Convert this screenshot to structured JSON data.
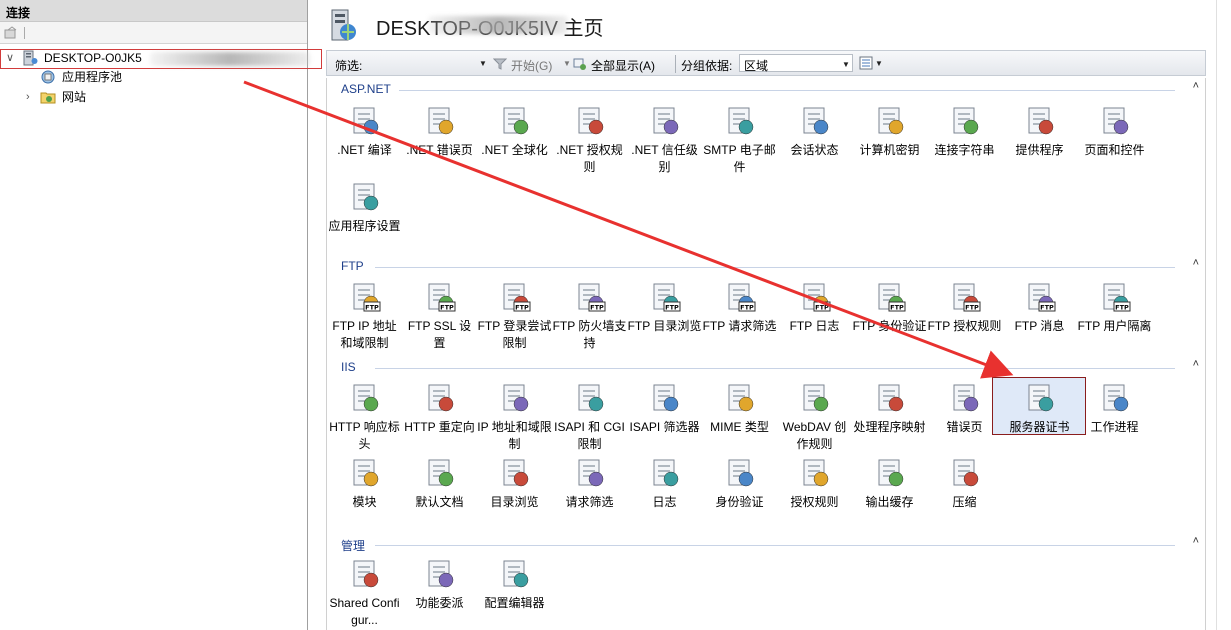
{
  "connections": {
    "header": "连接",
    "host": "DESKTOP-O0JK5",
    "items": [
      "应用程序池",
      "网站"
    ]
  },
  "page": {
    "title": "DESKTOP-O0JK5IV 主页"
  },
  "filter_bar": {
    "filter_label": "筛选:",
    "go_label": "开始(G)",
    "show_all_label": "全部显示(A)",
    "group_by_label": "分组依据:",
    "group_by_value": "区域"
  },
  "sections": [
    {
      "name": "ASP.NET",
      "items": [
        {
          "label": ".NET 编译",
          "icon": "net-compile-icon"
        },
        {
          "label": ".NET 错误页",
          "icon": "net-error-pages-icon"
        },
        {
          "label": ".NET 全球化",
          "icon": "net-globalization-icon"
        },
        {
          "label": ".NET 授权规则",
          "icon": "net-authorization-icon"
        },
        {
          "label": ".NET 信任级别",
          "icon": "net-trust-levels-icon"
        },
        {
          "label": "SMTP 电子邮件",
          "icon": "smtp-email-icon"
        },
        {
          "label": "会话状态",
          "icon": "session-state-icon"
        },
        {
          "label": "计算机密钥",
          "icon": "machine-key-icon"
        },
        {
          "label": "连接字符串",
          "icon": "connection-strings-icon"
        },
        {
          "label": "提供程序",
          "icon": "providers-icon"
        },
        {
          "label": "页面和控件",
          "icon": "pages-controls-icon"
        },
        {
          "label": "应用程序设置",
          "icon": "app-settings-icon"
        }
      ]
    },
    {
      "name": "FTP",
      "items": [
        {
          "label": "FTP IP 地址和域限制",
          "icon": "ftp-ip-icon"
        },
        {
          "label": "FTP SSL 设置",
          "icon": "ftp-ssl-icon"
        },
        {
          "label": "FTP 登录尝试限制",
          "icon": "ftp-logon-icon"
        },
        {
          "label": "FTP 防火墙支持",
          "icon": "ftp-firewall-icon"
        },
        {
          "label": "FTP 目录浏览",
          "icon": "ftp-dir-browse-icon"
        },
        {
          "label": "FTP 请求筛选",
          "icon": "ftp-request-filter-icon"
        },
        {
          "label": "FTP 日志",
          "icon": "ftp-logging-icon"
        },
        {
          "label": "FTP 身份验证",
          "icon": "ftp-auth-icon"
        },
        {
          "label": "FTP 授权规则",
          "icon": "ftp-authz-icon"
        },
        {
          "label": "FTP 消息",
          "icon": "ftp-messages-icon"
        },
        {
          "label": "FTP 用户隔离",
          "icon": "ftp-user-isolation-icon"
        }
      ]
    },
    {
      "name": "IIS",
      "items": [
        {
          "label": "HTTP 响应标头",
          "icon": "http-headers-icon"
        },
        {
          "label": "HTTP 重定向",
          "icon": "http-redirect-icon"
        },
        {
          "label": "IP 地址和域限制",
          "icon": "ip-restrictions-icon"
        },
        {
          "label": "ISAPI 和 CGI 限制",
          "icon": "isapi-cgi-icon"
        },
        {
          "label": "ISAPI 筛选器",
          "icon": "isapi-filters-icon"
        },
        {
          "label": "MIME 类型",
          "icon": "mime-types-icon"
        },
        {
          "label": "WebDAV 创作规则",
          "icon": "webdav-icon"
        },
        {
          "label": "处理程序映射",
          "icon": "handler-mappings-icon"
        },
        {
          "label": "错误页",
          "icon": "error-pages-icon"
        },
        {
          "label": "服务器证书",
          "icon": "server-certificates-icon"
        },
        {
          "label": "工作进程",
          "icon": "worker-processes-icon"
        },
        {
          "label": "模块",
          "icon": "modules-icon"
        },
        {
          "label": "默认文档",
          "icon": "default-document-icon"
        },
        {
          "label": "目录浏览",
          "icon": "directory-browsing-icon"
        },
        {
          "label": "请求筛选",
          "icon": "request-filtering-icon"
        },
        {
          "label": "日志",
          "icon": "logging-icon"
        },
        {
          "label": "身份验证",
          "icon": "authentication-icon"
        },
        {
          "label": "授权规则",
          "icon": "authorization-rules-icon"
        },
        {
          "label": "输出缓存",
          "icon": "output-caching-icon"
        },
        {
          "label": "压缩",
          "icon": "compression-icon"
        }
      ]
    },
    {
      "name": "管理",
      "items": [
        {
          "label": "Shared Configur...",
          "icon": "shared-config-icon"
        },
        {
          "label": "功能委派",
          "icon": "feature-delegation-icon"
        },
        {
          "label": "配置编辑器",
          "icon": "config-editor-icon"
        }
      ]
    }
  ],
  "colors": {
    "annotation": "#e8312f",
    "section_label": "#1e3f8a",
    "selected_bg": "#dfe9f8"
  }
}
